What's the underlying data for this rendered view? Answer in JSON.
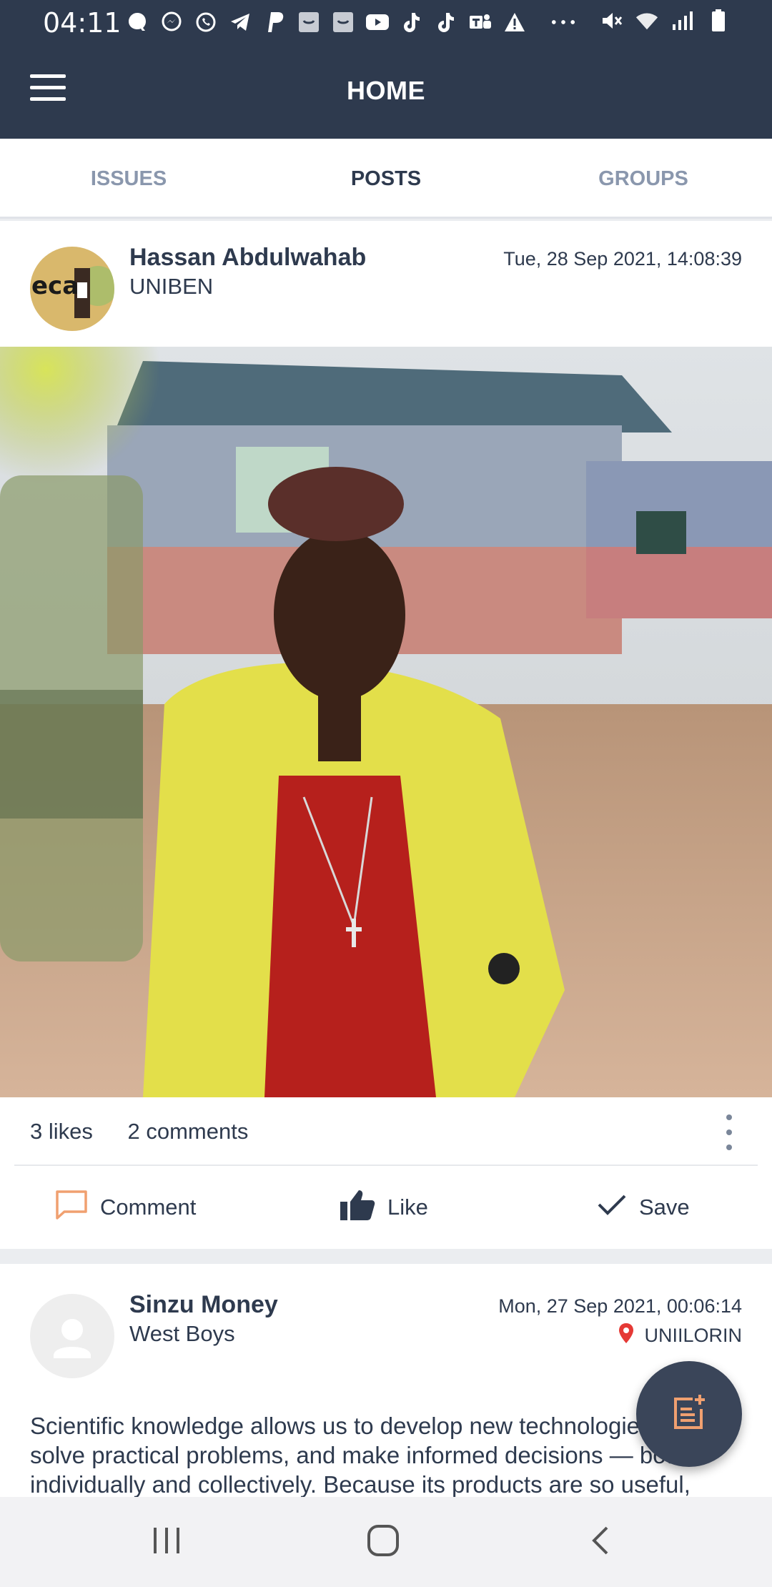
{
  "status_bar": {
    "time": "04:11",
    "icons": [
      "quora-icon",
      "messenger-icon",
      "whatsapp-icon",
      "telegram-icon",
      "paypal-icon",
      "app-icon",
      "app-icon",
      "youtube-icon",
      "tiktok-icon",
      "tiktok-icon",
      "teams-icon",
      "warning-icon",
      "more-icon"
    ],
    "right_icons": [
      "mute-icon",
      "wifi-icon",
      "signal-icon",
      "battery-icon"
    ]
  },
  "app_bar": {
    "title": "HOME"
  },
  "tabs": [
    {
      "label": "ISSUES",
      "active": false
    },
    {
      "label": "POSTS",
      "active": true
    },
    {
      "label": "GROUPS",
      "active": false
    }
  ],
  "posts": [
    {
      "author": "Hassan Abdulwahab",
      "subtitle": "UNIBEN",
      "timestamp": "Tue, 28 Sep 2021, 14:08:39",
      "avatar_text": "eca",
      "likes": "3 likes",
      "comments": "2 comments"
    },
    {
      "author": "Sinzu Money",
      "subtitle": "West Boys",
      "timestamp": "Mon, 27 Sep 2021, 00:06:14",
      "location": "UNIILORIN",
      "text_lines": [
        "Scientific knowledge allows us to develop new technologies,",
        "solve practical problems, and make informed decisions — both",
        "individually and collectively. Because its products are so useful,"
      ]
    }
  ],
  "actions": {
    "comment": "Comment",
    "like": "Like",
    "save": "Save"
  },
  "colors": {
    "header": "#2e3a4e",
    "comment_icon": "#f0a070",
    "location_pin": "#e53935"
  }
}
